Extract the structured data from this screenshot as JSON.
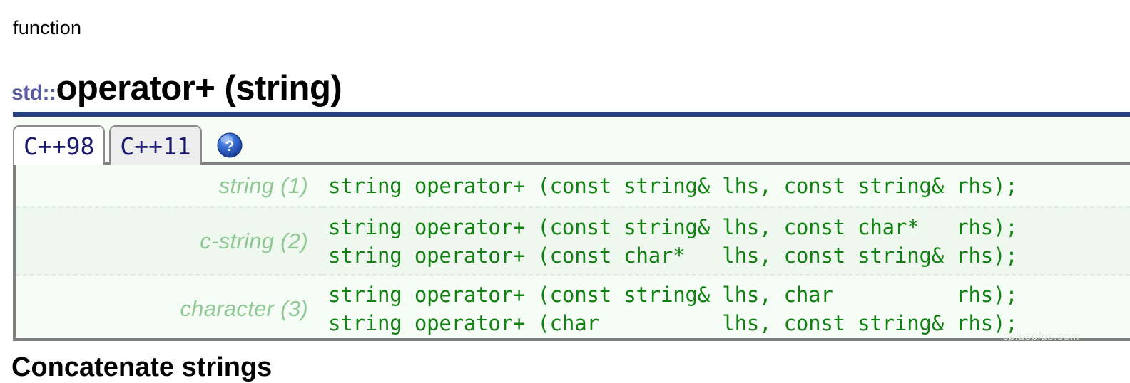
{
  "header": {
    "kind_label": "function",
    "namespace": "std::",
    "name": "operator+ (string)"
  },
  "tabs": [
    {
      "label": "C++98",
      "state": "active"
    },
    {
      "label": "C++11",
      "state": "inactive"
    }
  ],
  "help_icon": {
    "name": "help-icon",
    "glyph": "?",
    "color": "#2b63c8"
  },
  "signatures": {
    "rows": [
      {
        "label": "string (1)",
        "lines": [
          "string operator+ (const string& lhs, const string& rhs);"
        ]
      },
      {
        "label": "c-string (2)",
        "lines": [
          "string operator+ (const string& lhs, const char*   rhs);",
          "string operator+ (const char*   lhs, const string& rhs);"
        ]
      },
      {
        "label": "character (3)",
        "lines": [
          "string operator+ (const string& lhs, char          rhs);",
          "string operator+ (char          lhs, const string& rhs);"
        ]
      }
    ]
  },
  "watermark": {
    "text": "cplusplus.com"
  },
  "next_section": {
    "heading": "Concatenate strings"
  },
  "colors": {
    "rule_blue": "#26407e",
    "namespace_purple": "#5a5a9e",
    "tab_text_blue": "#1a1a6e",
    "code_green": "#128012",
    "label_green": "#8fc795",
    "box_border_gray": "#808080",
    "row_bg_light": "#f6fdf6",
    "row_bg_alt": "#eef8ee"
  }
}
